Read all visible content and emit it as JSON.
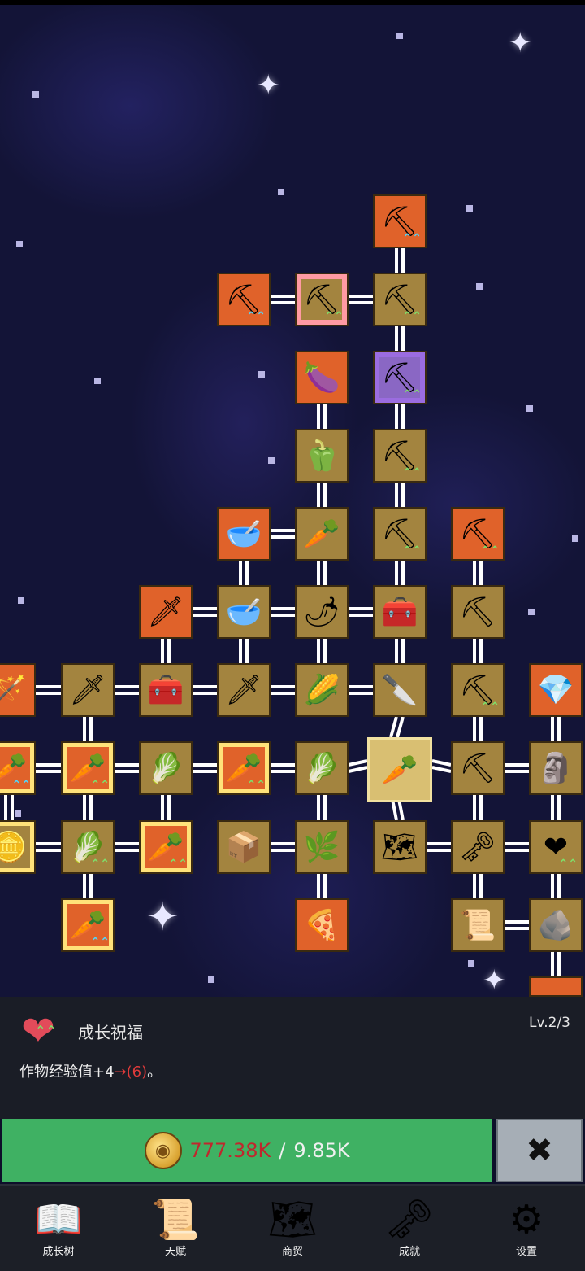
{
  "nodes": [
    {
      "id": "n-shovel-top",
      "icon": "⛏",
      "style": "o",
      "up": "blue"
    },
    {
      "id": "n-shovel-r2a",
      "icon": "⛏",
      "style": "o",
      "up": "blue"
    },
    {
      "id": "n-shovel-r2b",
      "icon": "⛏",
      "style": "t pink",
      "up": "green"
    },
    {
      "id": "n-shovel-r2c",
      "icon": "⛏",
      "style": "t",
      "up": "green"
    },
    {
      "id": "n-eggplant",
      "icon": "🍆",
      "style": "o",
      "up": ""
    },
    {
      "id": "n-shovel-purple",
      "icon": "⛏",
      "style": "purp",
      "up": "green"
    },
    {
      "id": "n-pepper",
      "icon": "🫑",
      "style": "t",
      "up": ""
    },
    {
      "id": "n-shovel-r4",
      "icon": "⛏",
      "style": "t",
      "up": "green"
    },
    {
      "id": "n-bowl-a",
      "icon": "🥣",
      "style": "o",
      "up": ""
    },
    {
      "id": "n-radish",
      "icon": "🥕",
      "style": "t",
      "up": ""
    },
    {
      "id": "n-shovel-r5",
      "icon": "⛏",
      "style": "t",
      "up": "green"
    },
    {
      "id": "n-pickaxe-a",
      "icon": "⛏",
      "style": "o",
      "up": "green"
    },
    {
      "id": "n-sword-a",
      "icon": "🗡",
      "style": "o",
      "up": ""
    },
    {
      "id": "n-bowl-b",
      "icon": "🥣",
      "style": "t",
      "up": ""
    },
    {
      "id": "n-chili",
      "icon": "🌶",
      "style": "t",
      "up": ""
    },
    {
      "id": "n-chest-a",
      "icon": "🧰",
      "style": "t",
      "up": ""
    },
    {
      "id": "n-pickaxe-b",
      "icon": "⛏",
      "style": "t",
      "up": ""
    },
    {
      "id": "n-staff",
      "icon": "🪄",
      "style": "o",
      "up": ""
    },
    {
      "id": "n-sword-b",
      "icon": "🗡",
      "style": "t",
      "up": ""
    },
    {
      "id": "n-chest-b",
      "icon": "🧰",
      "style": "t",
      "up": ""
    },
    {
      "id": "n-sword-c",
      "icon": "🗡",
      "style": "t",
      "up": ""
    },
    {
      "id": "n-corn",
      "icon": "🌽",
      "style": "t",
      "up": ""
    },
    {
      "id": "n-knife",
      "icon": "🔪",
      "style": "t",
      "up": ""
    },
    {
      "id": "n-pickaxe-c",
      "icon": "⛏",
      "style": "t",
      "up": "green"
    },
    {
      "id": "n-crystal",
      "icon": "💎",
      "style": "o",
      "up": ""
    },
    {
      "id": "n-carrot-a",
      "icon": "🥕",
      "style": "o gold",
      "up": "blue"
    },
    {
      "id": "n-carrot-b",
      "icon": "🥕",
      "style": "o gold",
      "up": "green"
    },
    {
      "id": "n-cabbage-a",
      "icon": "🥬",
      "style": "t",
      "up": ""
    },
    {
      "id": "n-carrot-c",
      "icon": "🥕",
      "style": "o gold",
      "up": "green"
    },
    {
      "id": "n-cabbage-b",
      "icon": "🥬",
      "style": "t",
      "up": ""
    },
    {
      "id": "n-carrot-sel",
      "icon": "🥕",
      "style": "sel",
      "up": ""
    },
    {
      "id": "n-pickaxe-d",
      "icon": "⛏",
      "style": "t",
      "up": ""
    },
    {
      "id": "n-statue",
      "icon": "🗿",
      "style": "t",
      "up": ""
    },
    {
      "id": "n-coin-pack",
      "icon": "🪙",
      "style": "t gold",
      "up": ""
    },
    {
      "id": "n-cabbage-c",
      "icon": "🥬",
      "style": "t",
      "up": "green"
    },
    {
      "id": "n-carrot-d",
      "icon": "🥕",
      "style": "o gold",
      "up": "green"
    },
    {
      "id": "n-treasure",
      "icon": "📦",
      "style": "t",
      "up": ""
    },
    {
      "id": "n-parsnip",
      "icon": "🌿",
      "style": "t",
      "up": ""
    },
    {
      "id": "n-map",
      "icon": "🗺",
      "style": "t",
      "up": ""
    },
    {
      "id": "n-key",
      "icon": "🗝",
      "style": "t",
      "up": ""
    },
    {
      "id": "n-heart",
      "icon": "❤",
      "style": "t",
      "up": "green"
    },
    {
      "id": "n-carrot-e",
      "icon": "🥕",
      "style": "o gold",
      "up": "blue"
    },
    {
      "id": "n-pizza",
      "icon": "🍕",
      "style": "o",
      "up": ""
    },
    {
      "id": "n-scroll",
      "icon": "📜",
      "style": "t",
      "up": ""
    },
    {
      "id": "n-rock",
      "icon": "🪨",
      "style": "t",
      "up": ""
    },
    {
      "id": "n-partial",
      "icon": "",
      "style": "o",
      "up": ""
    }
  ],
  "detail": {
    "icon": "heart-icon",
    "title": "成长祝福",
    "level": "Lv.2/3",
    "desc_prefix": "作物经验值+4",
    "desc_arrow": "→(6)",
    "desc_suffix": "。"
  },
  "purchase": {
    "cost": "777.38K",
    "separator": "/",
    "owned": "9.85K",
    "close_label": "✖"
  },
  "nav": [
    {
      "label": "成长树",
      "icon": "book-icon"
    },
    {
      "label": "天赋",
      "icon": "scroll-icon"
    },
    {
      "label": "商贸",
      "icon": "map-icon"
    },
    {
      "label": "成就",
      "icon": "key-icon"
    },
    {
      "label": "设置",
      "icon": "gear-icon"
    }
  ]
}
